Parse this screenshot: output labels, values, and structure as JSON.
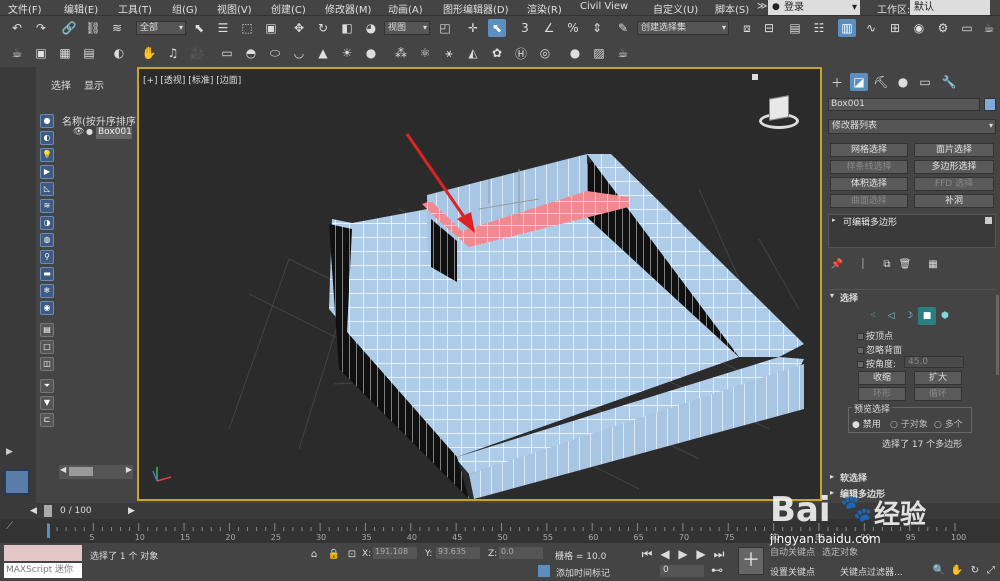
{
  "menubar": {
    "items": [
      "文件(F)",
      "编辑(E)",
      "工具(T)",
      "组(G)",
      "视图(V)",
      "创建(C)",
      "修改器(M)",
      "动画(A)",
      "图形编辑器(D)",
      "渲染(R)",
      "Civil View",
      "自定义(U)",
      "脚本(S)"
    ],
    "help_glyph": "≫",
    "login": "登录",
    "workspace_label": "工作区:",
    "workspace_value": "默认"
  },
  "toolbar": {
    "filter_dropdown": "全部",
    "refcoord_dropdown": "视图",
    "selection_set_dropdown": "创建选择集"
  },
  "scene_explorer": {
    "tab_select": "选择",
    "tab_display": "显示",
    "header": "名称(按升序排序)",
    "object_name": "Box001"
  },
  "viewport": {
    "label": "[+] [透视] [标准] [边面]"
  },
  "command_panel": {
    "object_name": "Box001",
    "modifier_list": "修改器列表",
    "buttons": [
      "网格选择",
      "面片选择",
      "样条线选择",
      "多边形选择",
      "体积选择",
      "FFD 选择",
      "曲面选择",
      "补洞"
    ],
    "stack_item": "可编辑多边形",
    "rollout_selection": "选择",
    "by_vertex": "按顶点",
    "ignore_backfacing": "忽略背面",
    "by_angle": "按角度:",
    "angle_value": "45.0",
    "shrink": "收缩",
    "grow": "扩大",
    "ring": "环形",
    "loop": "循环",
    "preview_selection": "预览选择",
    "preview_disabled": "禁用",
    "preview_subobject": "子对象",
    "preview_multi": "多个",
    "selection_status": "选择了 17 个多边形",
    "rollout_soft": "软选择",
    "rollout_edit": "编辑多边形"
  },
  "timeline": {
    "frame_counter": "0 / 100",
    "ticks": [
      "5",
      "10",
      "15",
      "20",
      "25",
      "30",
      "35",
      "40",
      "45",
      "50",
      "55",
      "60",
      "65",
      "70",
      "75",
      "80",
      "85",
      "90",
      "95",
      "100"
    ]
  },
  "status": {
    "maxscript": "MAXScript 迷你",
    "selected": "选择了 1 个 对象",
    "x_label": "X:",
    "x_value": "191.108",
    "y_label": "Y:",
    "y_value": "93.635",
    "z_label": "Z:",
    "z_value": "0.0",
    "grid": "栅格 = 10.0",
    "add_time_tag": "添加时间标记",
    "auto_key": "自动关键点",
    "selected_obj": "选定对象",
    "set_key": "设置关键点",
    "key_filters": "关键点过滤器...",
    "frame": "0"
  },
  "watermark": {
    "brand": "Bai",
    "brand2": "经验",
    "url": "jingyan.baidu.com"
  }
}
